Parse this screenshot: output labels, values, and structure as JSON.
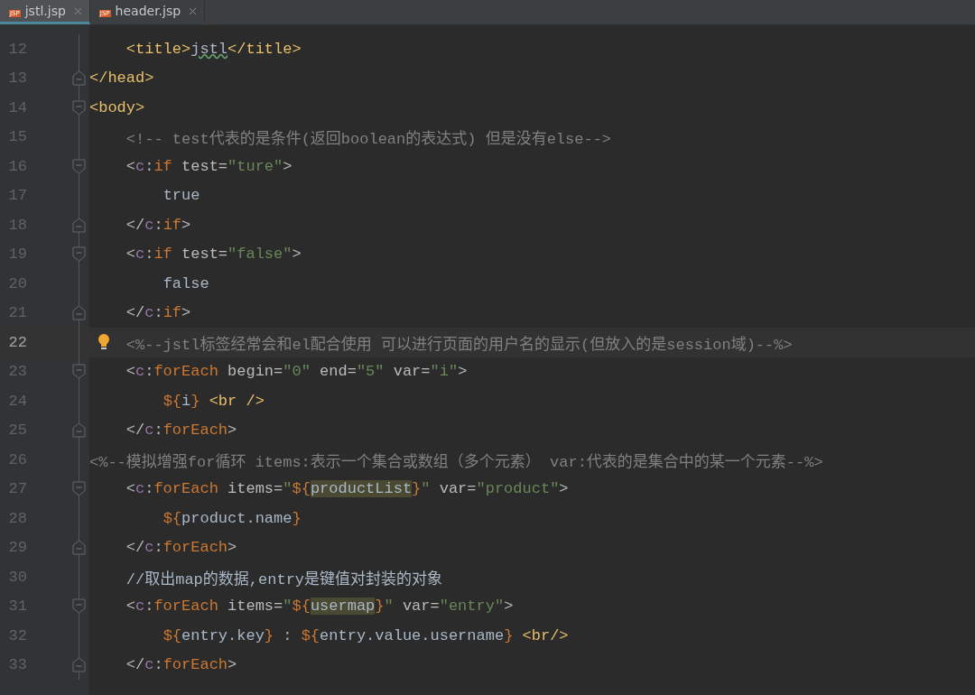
{
  "tabs": [
    {
      "label": "jstl.jsp",
      "selected": true,
      "badge": "JSP"
    },
    {
      "label": "header.jsp",
      "selected": false,
      "badge": "JSP"
    }
  ],
  "lines": [
    {
      "number": "12",
      "fold_start": false,
      "fold_end": false,
      "current": false,
      "hint": false,
      "tokens": [
        {
          "kind": "tag",
          "text": "    <title>"
        },
        {
          "kind": "typo",
          "text": "jstl"
        },
        {
          "kind": "tag",
          "text": "</title>"
        }
      ]
    },
    {
      "number": "13",
      "fold_start": false,
      "fold_end": true,
      "current": false,
      "hint": false,
      "tokens": [
        {
          "kind": "tag",
          "text": "</head>"
        }
      ]
    },
    {
      "number": "14",
      "fold_start": true,
      "fold_end": false,
      "current": false,
      "hint": false,
      "tokens": [
        {
          "kind": "tag",
          "text": "<body>"
        }
      ]
    },
    {
      "number": "15",
      "fold_start": false,
      "fold_end": false,
      "current": false,
      "hint": false,
      "tokens": [
        {
          "kind": "comment",
          "text": "    <!-- test代表的是条件(返回boolean的表达式) 但是没有else-->"
        }
      ]
    },
    {
      "number": "16",
      "fold_start": true,
      "fold_end": false,
      "current": false,
      "hint": false,
      "tokens": [
        {
          "kind": "punct",
          "text": "    <"
        },
        {
          "kind": "ns",
          "text": "c"
        },
        {
          "kind": "punct",
          "text": ":"
        },
        {
          "kind": "keyword",
          "text": "if"
        },
        {
          "kind": "attr",
          "text": " test="
        },
        {
          "kind": "value",
          "text": "\"ture\""
        },
        {
          "kind": "punct",
          "text": ">"
        }
      ]
    },
    {
      "number": "17",
      "fold_start": false,
      "fold_end": false,
      "current": false,
      "hint": false,
      "tokens": [
        {
          "kind": "text",
          "text": "        true"
        }
      ]
    },
    {
      "number": "18",
      "fold_start": false,
      "fold_end": true,
      "current": false,
      "hint": false,
      "tokens": [
        {
          "kind": "punct",
          "text": "    </"
        },
        {
          "kind": "ns",
          "text": "c"
        },
        {
          "kind": "punct",
          "text": ":"
        },
        {
          "kind": "keyword",
          "text": "if"
        },
        {
          "kind": "punct",
          "text": ">"
        }
      ]
    },
    {
      "number": "19",
      "fold_start": true,
      "fold_end": false,
      "current": false,
      "hint": false,
      "tokens": [
        {
          "kind": "punct",
          "text": "    <"
        },
        {
          "kind": "ns",
          "text": "c"
        },
        {
          "kind": "punct",
          "text": ":"
        },
        {
          "kind": "keyword",
          "text": "if"
        },
        {
          "kind": "attr",
          "text": " test="
        },
        {
          "kind": "value",
          "text": "\"false\""
        },
        {
          "kind": "punct",
          "text": ">"
        }
      ]
    },
    {
      "number": "20",
      "fold_start": false,
      "fold_end": false,
      "current": false,
      "hint": false,
      "tokens": [
        {
          "kind": "text",
          "text": "        false"
        }
      ]
    },
    {
      "number": "21",
      "fold_start": false,
      "fold_end": true,
      "current": false,
      "hint": false,
      "tokens": [
        {
          "kind": "punct",
          "text": "    </"
        },
        {
          "kind": "ns",
          "text": "c"
        },
        {
          "kind": "punct",
          "text": ":"
        },
        {
          "kind": "keyword",
          "text": "if"
        },
        {
          "kind": "punct",
          "text": ">"
        }
      ]
    },
    {
      "number": "22",
      "fold_start": false,
      "fold_end": false,
      "current": true,
      "hint": true,
      "tokens": [
        {
          "kind": "comment",
          "text": "    <%--jstl标签经常会和el配合使用 可以进行页面的用户名的显示(但放入的是session域)--%>"
        }
      ]
    },
    {
      "number": "23",
      "fold_start": true,
      "fold_end": false,
      "current": false,
      "hint": false,
      "tokens": [
        {
          "kind": "punct",
          "text": "    <"
        },
        {
          "kind": "ns",
          "text": "c"
        },
        {
          "kind": "punct",
          "text": ":"
        },
        {
          "kind": "keyword",
          "text": "forEach"
        },
        {
          "kind": "attr",
          "text": " begin="
        },
        {
          "kind": "value",
          "text": "\"0\""
        },
        {
          "kind": "attr",
          "text": " end="
        },
        {
          "kind": "value",
          "text": "\"5\""
        },
        {
          "kind": "attr",
          "text": " var="
        },
        {
          "kind": "value",
          "text": "\"i\""
        },
        {
          "kind": "punct",
          "text": ">"
        }
      ]
    },
    {
      "number": "24",
      "fold_start": false,
      "fold_end": false,
      "current": false,
      "hint": false,
      "tokens": [
        {
          "kind": "el",
          "text": "        ${"
        },
        {
          "kind": "text",
          "text": "i"
        },
        {
          "kind": "el",
          "text": "}"
        },
        {
          "kind": "tag",
          "text": " <br />"
        }
      ]
    },
    {
      "number": "25",
      "fold_start": false,
      "fold_end": true,
      "current": false,
      "hint": false,
      "tokens": [
        {
          "kind": "punct",
          "text": "    </"
        },
        {
          "kind": "ns",
          "text": "c"
        },
        {
          "kind": "punct",
          "text": ":"
        },
        {
          "kind": "keyword",
          "text": "forEach"
        },
        {
          "kind": "punct",
          "text": ">"
        }
      ]
    },
    {
      "number": "26",
      "fold_start": false,
      "fold_end": false,
      "current": false,
      "hint": false,
      "tokens": [
        {
          "kind": "comment",
          "text": "<%--模拟增强for循环 items:表示一个集合或数组（多个元素） var:代表的是集合中的某一个元素--%>"
        }
      ]
    },
    {
      "number": "27",
      "fold_start": true,
      "fold_end": false,
      "current": false,
      "hint": false,
      "tokens": [
        {
          "kind": "punct",
          "text": "    <"
        },
        {
          "kind": "ns",
          "text": "c"
        },
        {
          "kind": "punct",
          "text": ":"
        },
        {
          "kind": "keyword",
          "text": "forEach"
        },
        {
          "kind": "attr",
          "text": " items="
        },
        {
          "kind": "value",
          "text": "\""
        },
        {
          "kind": "el",
          "text": "${"
        },
        {
          "kind": "match",
          "text": "productList"
        },
        {
          "kind": "el",
          "text": "}"
        },
        {
          "kind": "value",
          "text": "\""
        },
        {
          "kind": "attr",
          "text": " var="
        },
        {
          "kind": "value",
          "text": "\"product\""
        },
        {
          "kind": "punct",
          "text": ">"
        }
      ]
    },
    {
      "number": "28",
      "fold_start": false,
      "fold_end": false,
      "current": false,
      "hint": false,
      "tokens": [
        {
          "kind": "el",
          "text": "        ${"
        },
        {
          "kind": "text",
          "text": "product.name"
        },
        {
          "kind": "el",
          "text": "}"
        }
      ]
    },
    {
      "number": "29",
      "fold_start": false,
      "fold_end": true,
      "current": false,
      "hint": false,
      "tokens": [
        {
          "kind": "punct",
          "text": "    </"
        },
        {
          "kind": "ns",
          "text": "c"
        },
        {
          "kind": "punct",
          "text": ":"
        },
        {
          "kind": "keyword",
          "text": "forEach"
        },
        {
          "kind": "punct",
          "text": ">"
        }
      ]
    },
    {
      "number": "30",
      "fold_start": false,
      "fold_end": false,
      "current": false,
      "hint": false,
      "tokens": [
        {
          "kind": "text",
          "text": "    //取出map的数据,entry是键值对封装的对象"
        }
      ]
    },
    {
      "number": "31",
      "fold_start": true,
      "fold_end": false,
      "current": false,
      "hint": false,
      "tokens": [
        {
          "kind": "punct",
          "text": "    <"
        },
        {
          "kind": "ns",
          "text": "c"
        },
        {
          "kind": "punct",
          "text": ":"
        },
        {
          "kind": "keyword",
          "text": "forEach"
        },
        {
          "kind": "attr",
          "text": " items="
        },
        {
          "kind": "value",
          "text": "\""
        },
        {
          "kind": "el",
          "text": "${"
        },
        {
          "kind": "match",
          "text": "usermap"
        },
        {
          "kind": "el",
          "text": "}"
        },
        {
          "kind": "value",
          "text": "\""
        },
        {
          "kind": "attr",
          "text": " var="
        },
        {
          "kind": "value",
          "text": "\"entry\""
        },
        {
          "kind": "punct",
          "text": ">"
        }
      ]
    },
    {
      "number": "32",
      "fold_start": false,
      "fold_end": false,
      "current": false,
      "hint": false,
      "tokens": [
        {
          "kind": "el",
          "text": "        ${"
        },
        {
          "kind": "text",
          "text": "entry.key"
        },
        {
          "kind": "el",
          "text": "}"
        },
        {
          "kind": "text",
          "text": " : "
        },
        {
          "kind": "el",
          "text": "${"
        },
        {
          "kind": "text",
          "text": "entry.value.username"
        },
        {
          "kind": "el",
          "text": "}"
        },
        {
          "kind": "tag",
          "text": " <br/>"
        }
      ]
    },
    {
      "number": "33",
      "fold_start": false,
      "fold_end": true,
      "current": false,
      "hint": false,
      "tokens": [
        {
          "kind": "punct",
          "text": "    </"
        },
        {
          "kind": "ns",
          "text": "c"
        },
        {
          "kind": "punct",
          "text": ":"
        },
        {
          "kind": "keyword",
          "text": "forEach"
        },
        {
          "kind": "punct",
          "text": ">"
        }
      ]
    }
  ]
}
